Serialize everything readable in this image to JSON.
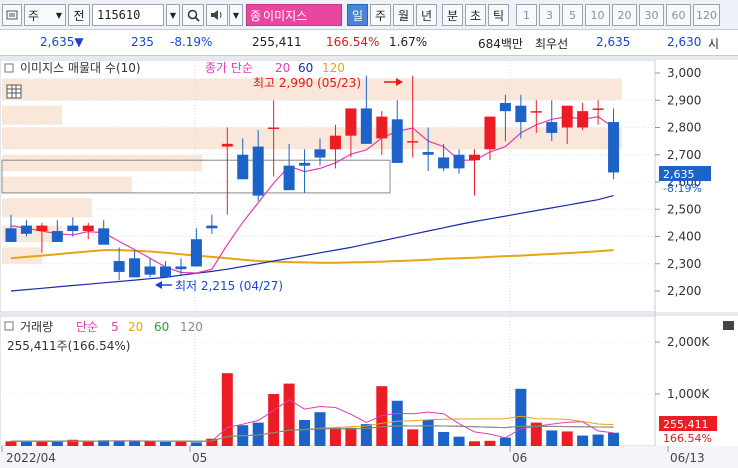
{
  "toolbar": {
    "market": "주",
    "period_short": "전",
    "code": "115610",
    "stock_prefix": "종",
    "stock_name": "이미지스",
    "tabs": [
      "일",
      "주",
      "월",
      "년",
      "분",
      "초",
      "틱"
    ],
    "active_tab": 0,
    "intervals": [
      "1",
      "3",
      "5",
      "10",
      "20",
      "30",
      "60",
      "120"
    ]
  },
  "quote": {
    "price": "2,635▼",
    "change": "235",
    "change_pct": "-8.19%",
    "volume": "255,411",
    "volume_ratio": "166.54%",
    "turnover_ratio": "1.67%",
    "trade_value": "684백만",
    "best_label": "최우선",
    "ask": "2,635",
    "bid": "2,630",
    "open_label": "시"
  },
  "price_panel": {
    "legend_name": "이미지스 매물대 수(10)",
    "legend_ma_prefix": "종가 단순",
    "legend_ma_periods": [
      "20",
      "60",
      "120"
    ],
    "high_label": "최고 2,990 (05/23)",
    "low_label": "최저 2,215 (04/27)",
    "current_price_tag": "2,635",
    "current_pct_tag": "-8.19%",
    "y_ticks": [
      "3,000",
      "2,900",
      "2,800",
      "2,700",
      "2,600",
      "2,500",
      "2,400",
      "2,300",
      "2,200"
    ],
    "colors": {
      "up": "#ec1c24",
      "down": "#1c62c8",
      "ma5": "#e33cb3",
      "ma20": "#1b2aa8",
      "ma60": "#e8a413",
      "profile": "#f7e2d1"
    }
  },
  "volume_panel": {
    "legend_name": "거래량",
    "legend_ma_prefix": "단순",
    "legend_ma_periods": [
      "5",
      "20",
      "60",
      "120"
    ],
    "volume_text": "255,411주(166.54%)",
    "y_ticks": [
      "2,000K",
      "1,000K"
    ],
    "current_volume_tag": "255,411",
    "current_pct_tag": "166.54%"
  },
  "x_axis": {
    "labels": [
      "2022/04",
      "05",
      "06",
      "06/13"
    ]
  },
  "chart_data": {
    "type": "candlestick",
    "x": [
      1,
      2,
      3,
      4,
      5,
      6,
      7,
      8,
      9,
      10,
      11,
      12,
      13,
      14,
      15,
      16,
      17,
      18,
      19,
      20,
      21,
      22,
      23,
      24,
      25,
      26,
      27,
      28,
      29,
      30,
      31,
      32,
      33,
      34,
      35,
      36,
      37,
      38,
      39,
      40
    ],
    "open": [
      2430,
      2440,
      2420,
      2420,
      2440,
      2420,
      2430,
      2310,
      2320,
      2290,
      2290,
      2290,
      2390,
      2440,
      2730,
      2700,
      2730,
      2800,
      2660,
      2670,
      2720,
      2720,
      2770,
      2870,
      2760,
      2830,
      2750,
      2710,
      2690,
      2700,
      2680,
      2720,
      2890,
      2880,
      2860,
      2820,
      2800,
      2800,
      2870,
      2820
    ],
    "high": [
      2480,
      2460,
      2450,
      2460,
      2470,
      2450,
      2460,
      2360,
      2350,
      2320,
      2310,
      2320,
      2430,
      2480,
      2800,
      2760,
      2790,
      2900,
      2740,
      2720,
      2760,
      2810,
      2800,
      2990,
      2860,
      2900,
      2990,
      2800,
      2740,
      2720,
      2720,
      2770,
      2920,
      2920,
      2900,
      2900,
      2870,
      2890,
      2900,
      2870
    ],
    "low": [
      2380,
      2400,
      2340,
      2380,
      2400,
      2390,
      2400,
      2240,
      2260,
      2250,
      2250,
      2260,
      2330,
      2410,
      2480,
      2660,
      2530,
      2620,
      2610,
      2560,
      2660,
      2650,
      2690,
      2740,
      2700,
      2750,
      2690,
      2640,
      2640,
      2630,
      2550,
      2680,
      2750,
      2760,
      2780,
      2750,
      2740,
      2790,
      2810,
      2610
    ],
    "close": [
      2380,
      2410,
      2440,
      2380,
      2420,
      2440,
      2370,
      2270,
      2250,
      2260,
      2250,
      2280,
      2290,
      2430,
      2740,
      2610,
      2550,
      2800,
      2570,
      2660,
      2690,
      2770,
      2870,
      2740,
      2840,
      2670,
      2750,
      2700,
      2650,
      2650,
      2700,
      2840,
      2860,
      2820,
      2860,
      2780,
      2880,
      2860,
      2870,
      2635
    ],
    "volume": [
      90,
      100,
      80,
      90,
      120,
      85,
      110,
      100,
      90,
      100,
      80,
      90,
      70,
      140,
      1400,
      400,
      450,
      1000,
      1200,
      500,
      650,
      350,
      350,
      420,
      1150,
      870,
      320,
      500,
      270,
      180,
      90,
      100,
      160,
      1100,
      450,
      300,
      280,
      200,
      220,
      255
    ],
    "volume_unit": "K",
    "volume_up": [
      true,
      false,
      true,
      false,
      true,
      true,
      false,
      false,
      false,
      true,
      false,
      true,
      false,
      true,
      true,
      false,
      false,
      true,
      true,
      false,
      false,
      true,
      true,
      false,
      true,
      false,
      true,
      false,
      false,
      false,
      true,
      true,
      false,
      false,
      true,
      false,
      true,
      false,
      false,
      false
    ],
    "ylim_price": [
      2150,
      3050
    ],
    "ylim_volume": [
      0,
      2400
    ],
    "ma5": [
      2440,
      2430,
      2420,
      2410,
      2406,
      2418,
      2414,
      2382,
      2352,
      2320,
      2288,
      2268,
      2266,
      2280,
      2370,
      2452,
      2524,
      2596,
      2658,
      2638,
      2650,
      2670,
      2702,
      2718,
      2762,
      2786,
      2798,
      2750,
      2730,
      2680,
      2680,
      2710,
      2730,
      2780,
      2810,
      2830,
      2840,
      2830,
      2840,
      2800
    ],
    "ma20": [
      2200,
      2205,
      2210,
      2215,
      2220,
      2225,
      2230,
      2235,
      2240,
      2245,
      2250,
      2258,
      2265,
      2272,
      2280,
      2290,
      2300,
      2310,
      2320,
      2330,
      2340,
      2350,
      2360,
      2372,
      2384,
      2396,
      2408,
      2420,
      2432,
      2444,
      2455,
      2465,
      2475,
      2485,
      2495,
      2505,
      2515,
      2525,
      2535,
      2550
    ],
    "ma60": [
      2320,
      2325,
      2330,
      2335,
      2340,
      2345,
      2350,
      2350,
      2348,
      2345,
      2340,
      2335,
      2330,
      2325,
      2320,
      2315,
      2310,
      2308,
      2306,
      2305,
      2304,
      2304,
      2305,
      2306,
      2308,
      2310,
      2312,
      2315,
      2318,
      2320,
      2322,
      2325,
      2328,
      2330,
      2333,
      2336,
      2339,
      2342,
      2346,
      2350
    ]
  }
}
